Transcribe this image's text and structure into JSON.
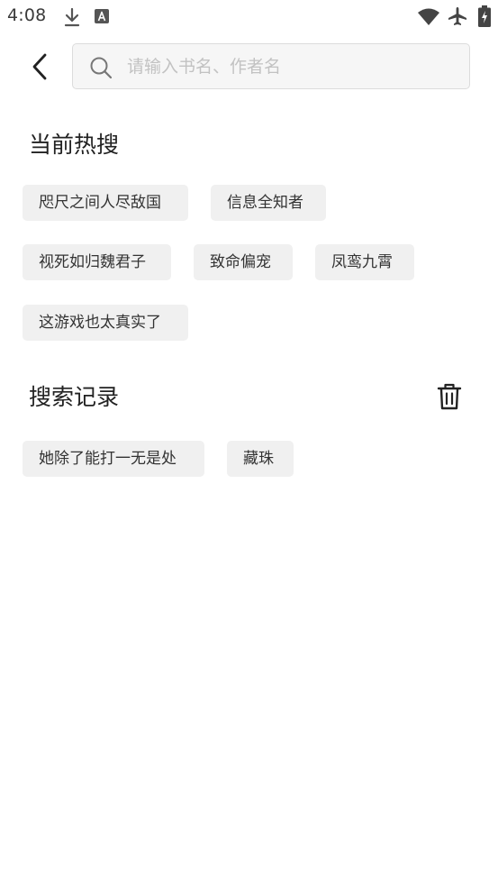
{
  "status_bar": {
    "time": "4:08",
    "icons": [
      "download-icon",
      "a-text-icon",
      "wifi-icon",
      "airplane-icon",
      "battery-icon"
    ]
  },
  "header": {
    "back_icon": "chevron-left-icon",
    "search": {
      "placeholder": "请输入书名、作者名",
      "value": "",
      "icon": "search-icon"
    }
  },
  "hot_search": {
    "title": "当前热搜",
    "tags": [
      "咫尺之间人尽敌国",
      "信息全知者",
      "视死如归魏君子",
      "致命偏宠",
      "凤鸾九霄",
      "这游戏也太真实了"
    ]
  },
  "history": {
    "title": "搜索记录",
    "clear_icon": "trash-icon",
    "tags": [
      "她除了能打一无是处",
      "藏珠"
    ]
  },
  "colors": {
    "tag_bg": "#f0f0f0",
    "search_bg": "#f6f6f6",
    "placeholder": "#c2c2c2",
    "text": "#222222"
  }
}
